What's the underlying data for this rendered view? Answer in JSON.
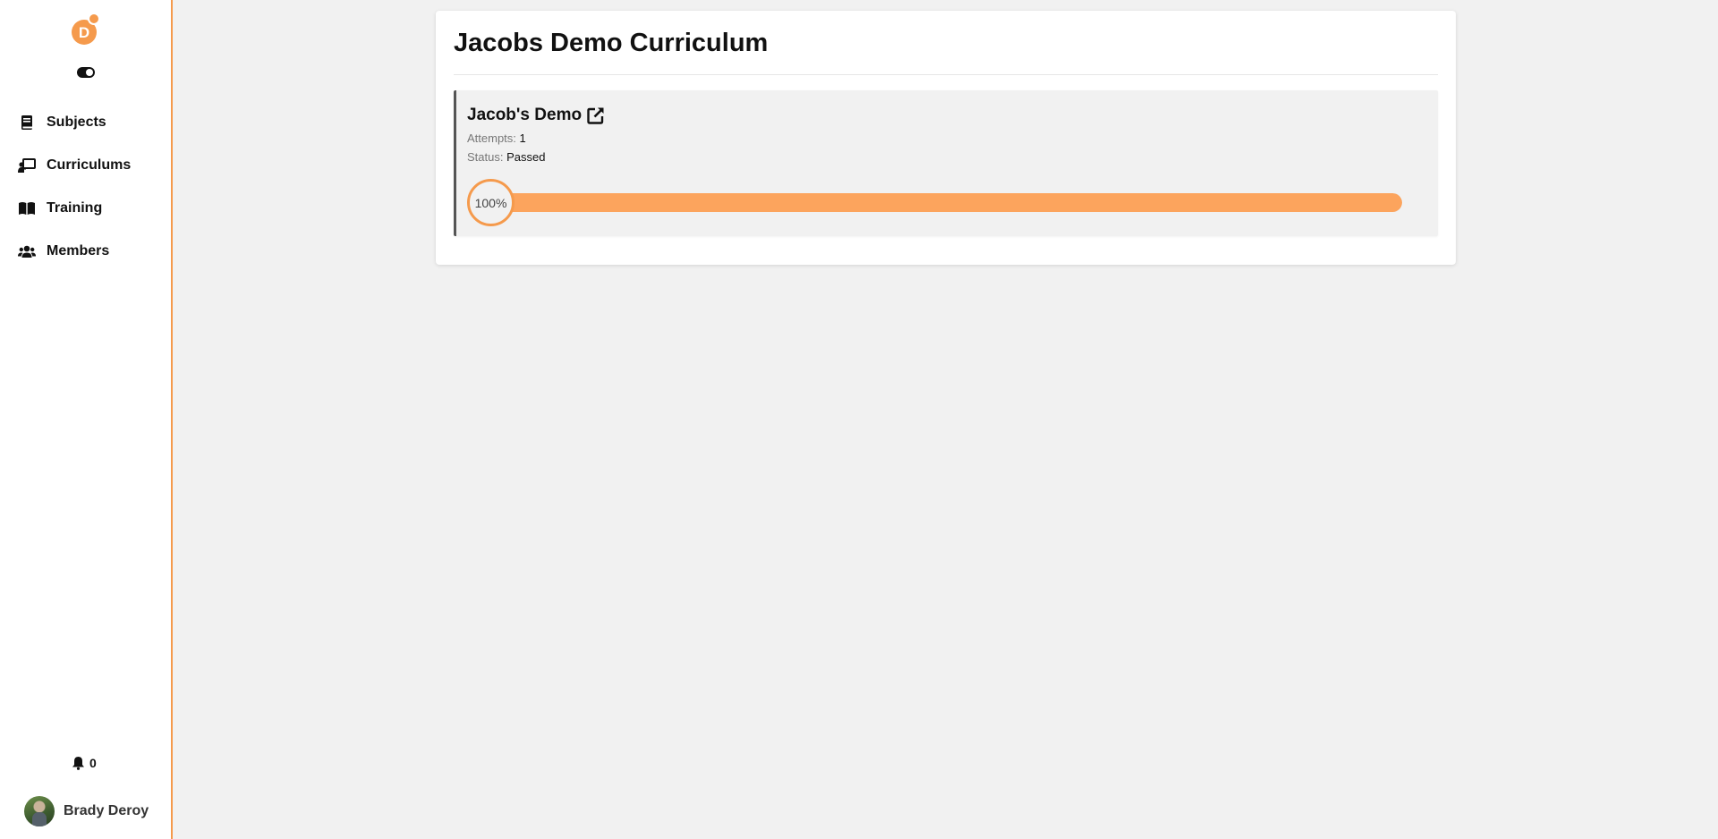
{
  "colors": {
    "accent": "#f59a4c",
    "progress_fill": "#fca45d"
  },
  "sidebar": {
    "logo_letter": "D",
    "items": [
      {
        "label": "Subjects",
        "icon": "book-icon"
      },
      {
        "label": "Curriculums",
        "icon": "chalkboard-teacher-icon"
      },
      {
        "label": "Training",
        "icon": "open-book-icon"
      },
      {
        "label": "Members",
        "icon": "users-icon"
      }
    ],
    "notifications": {
      "count": "0",
      "icon": "bell-icon"
    },
    "user": {
      "name": "Brady Deroy"
    }
  },
  "main": {
    "title": "Jacobs Demo Curriculum",
    "modules": [
      {
        "title": "Jacob's Demo",
        "attempts_label": "Attempts:",
        "attempts_value": "1",
        "status_label": "Status:",
        "status_value": "Passed",
        "progress_text": "100%",
        "progress_percent": 100
      }
    ]
  }
}
